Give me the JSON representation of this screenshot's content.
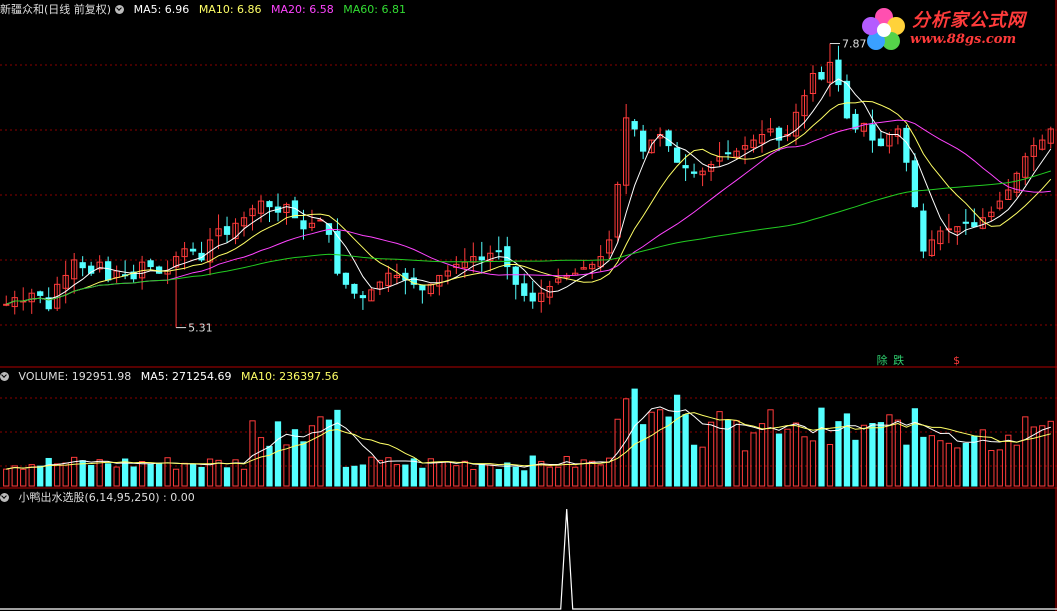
{
  "main_header": {
    "title": "新疆众和(日线 前复权)",
    "ma5": "MA5: 6.96",
    "ma10": "MA10: 6.86",
    "ma20": "MA20: 6.58",
    "ma60": "MA60: 6.81"
  },
  "volume_header": {
    "title": "VOLUME: 192951.98",
    "ma5": "MA5: 271254.69",
    "ma10": "MA10: 236397.56"
  },
  "indicator_header": {
    "title": "小鸭出水选股(6,14,95,250) : 0.00"
  },
  "watermark": {
    "title": "分析家公式网",
    "url": "www.88gs.com"
  },
  "colors": {
    "up": "#ff3b3b",
    "down": "#54ffff",
    "ma5": "#ffffff",
    "ma10": "#ffff66",
    "ma20": "#ff44ff",
    "ma60": "#22cc22",
    "grid": "#8a0000",
    "divider": "#b00000"
  },
  "chart_data": [
    {
      "type": "candlestick",
      "title": "新疆众和(日线 前复权)",
      "ylim": [
        5.0,
        8.1
      ],
      "annotations": [
        {
          "text": "7.87",
          "label": "period high",
          "value": 7.87
        },
        {
          "text": "5.31",
          "label": "period low",
          "value": 5.31
        }
      ],
      "markers": [
        "除",
        "跌",
        "$"
      ],
      "close_series_estimated": [
        5.52,
        5.58,
        5.55,
        5.62,
        5.6,
        5.48,
        5.7,
        5.78,
        5.92,
        5.85,
        5.8,
        5.9,
        5.74,
        5.82,
        5.78,
        5.75,
        5.9,
        5.86,
        5.8,
        5.82,
        5.95,
        6.02,
        6.0,
        5.92,
        6.1,
        6.2,
        6.15,
        6.25,
        6.3,
        6.38,
        6.45,
        6.4,
        6.35,
        6.42,
        6.3,
        6.2,
        6.25,
        6.28,
        6.15,
        5.8,
        5.7,
        5.62,
        5.58,
        5.65,
        5.72,
        5.8,
        5.78,
        5.74,
        5.7,
        5.65,
        5.7,
        5.78,
        5.82,
        5.88,
        5.9,
        5.95,
        5.92,
        5.98,
        6.0,
        5.86,
        5.7,
        5.6,
        5.55,
        5.62,
        5.68,
        5.75,
        5.78,
        5.8,
        5.85,
        5.88,
        5.95,
        6.1,
        6.6,
        7.2,
        7.1,
        6.9,
        7.0,
        7.05,
        6.95,
        6.8,
        6.75,
        6.7,
        6.72,
        6.78,
        6.85,
        6.88,
        6.9,
        6.95,
        7.0,
        7.05,
        7.1,
        7.0,
        7.05,
        7.25,
        7.4,
        7.6,
        7.55,
        7.7,
        7.5,
        7.2,
        7.1,
        7.15,
        7.0,
        6.95,
        7.05,
        7.1,
        6.8,
        6.4,
        6.0,
        6.1,
        6.18,
        6.2,
        6.22,
        6.25,
        6.22,
        6.3,
        6.35,
        6.45,
        6.55,
        6.7,
        6.85,
        6.95,
        7.0,
        7.1
      ]
    },
    {
      "type": "bar",
      "title": "VOLUME: 192951.98",
      "series": [
        {
          "name": "MA5",
          "last": 271254.69
        },
        {
          "name": "MA10",
          "last": 236397.56
        }
      ]
    },
    {
      "type": "line",
      "title": "小鸭出水选股(6,14,95,250) : 0.00",
      "ylim": [
        0,
        1
      ],
      "values_estimated": "0 everywhere except a single spike of 1 near the final third of the period"
    }
  ]
}
